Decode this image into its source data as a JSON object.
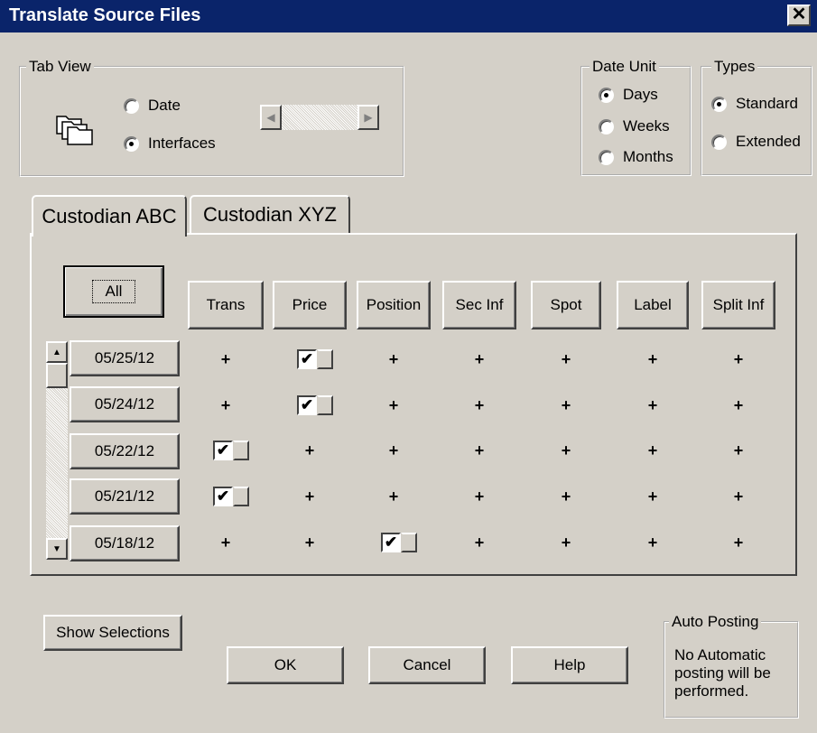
{
  "window": {
    "title": "Translate Source Files",
    "close_glyph": "✕"
  },
  "tab_view": {
    "legend": "Tab View",
    "icon": "stacked-folders-icon",
    "options": [
      {
        "label": "Date",
        "selected": false
      },
      {
        "label": "Interfaces",
        "selected": true
      }
    ],
    "scroll_left_glyph": "◀",
    "scroll_right_glyph": "▶"
  },
  "date_unit": {
    "legend": "Date Unit",
    "options": [
      {
        "label": "Days",
        "selected": true
      },
      {
        "label": "Weeks",
        "selected": false
      },
      {
        "label": "Months",
        "selected": false
      }
    ]
  },
  "types": {
    "legend": "Types",
    "options": [
      {
        "label": "Standard",
        "selected": true
      },
      {
        "label": "Extended",
        "selected": false
      }
    ]
  },
  "tabs": [
    {
      "label": "Custodian ABC",
      "active": true
    },
    {
      "label": "Custodian XYZ",
      "active": false
    }
  ],
  "grid": {
    "all_label": "All",
    "columns": [
      "Trans",
      "Price",
      "Position",
      "Sec Inf",
      "Spot",
      "Label",
      "Split Inf"
    ],
    "rows": [
      {
        "date": "05/25/12",
        "cells": [
          "+",
          "✔",
          "+",
          "+",
          "+",
          "+",
          "+"
        ]
      },
      {
        "date": "05/24/12",
        "cells": [
          "+",
          "✔",
          "+",
          "+",
          "+",
          "+",
          "+"
        ]
      },
      {
        "date": "05/22/12",
        "cells": [
          "✔",
          "+",
          "+",
          "+",
          "+",
          "+",
          "+"
        ]
      },
      {
        "date": "05/21/12",
        "cells": [
          "✔",
          "+",
          "+",
          "+",
          "+",
          "+",
          "+"
        ]
      },
      {
        "date": "05/18/12",
        "cells": [
          "+",
          "+",
          "✔",
          "+",
          "+",
          "+",
          "+"
        ]
      }
    ],
    "scroll_up_glyph": "▲",
    "scroll_down_glyph": "▼"
  },
  "buttons": {
    "show_selections": "Show Selections",
    "ok": "OK",
    "cancel": "Cancel",
    "help": "Help"
  },
  "auto_posting": {
    "legend": "Auto Posting",
    "lines": [
      "No Automatic",
      "posting will be",
      "performed."
    ]
  }
}
